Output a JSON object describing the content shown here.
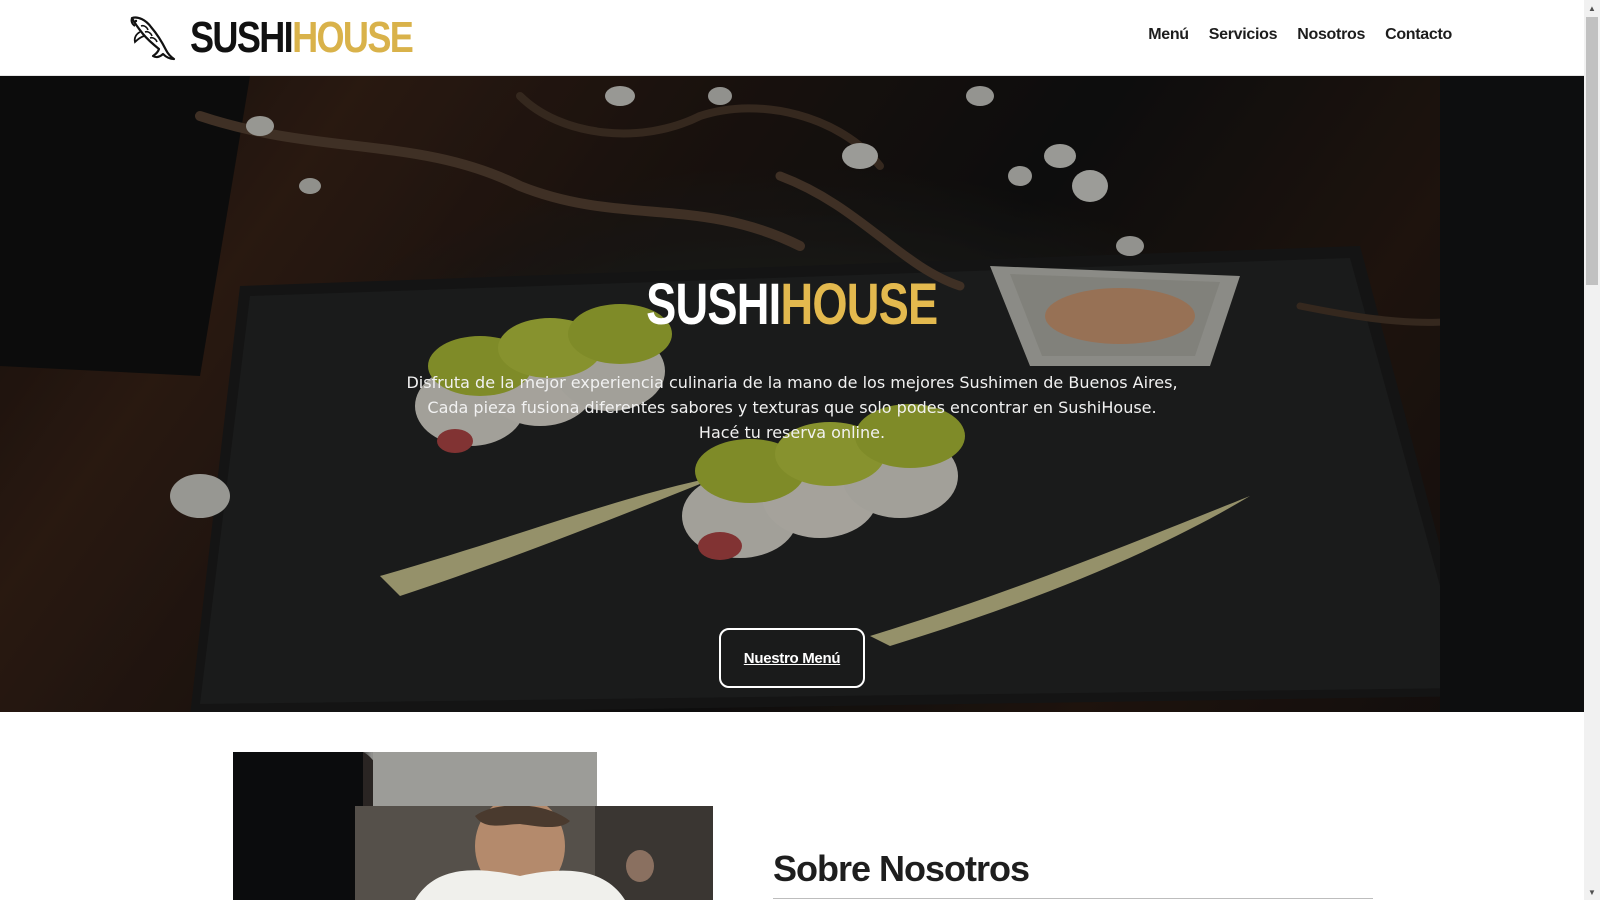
{
  "header": {
    "logo": {
      "fish_icon": "koi-fish-icon",
      "text_part1": "SUSHI",
      "text_part2": "HOUSE"
    },
    "nav": [
      {
        "label": "Menú"
      },
      {
        "label": "Servicios"
      },
      {
        "label": "Nosotros"
      },
      {
        "label": "Contacto"
      }
    ]
  },
  "hero": {
    "title_part1": "SUSHI",
    "title_part2": "HOUSE",
    "description_lines": [
      "Disfruta de la mejor experiencia culinaria de la mano de los mejores Sushimen de Buenos Aires,",
      "Cada pieza fusiona diferentes sabores y texturas que solo podes encontrar en SushiHouse.",
      "Hacé tu reserva online."
    ],
    "button_label": "Nuestro Menú"
  },
  "about": {
    "title": "Sobre Nosotros"
  },
  "colors": {
    "accent": "#d9b24a",
    "hero_accent": "#e3b94e",
    "text_dark": "#1d1d1d"
  }
}
